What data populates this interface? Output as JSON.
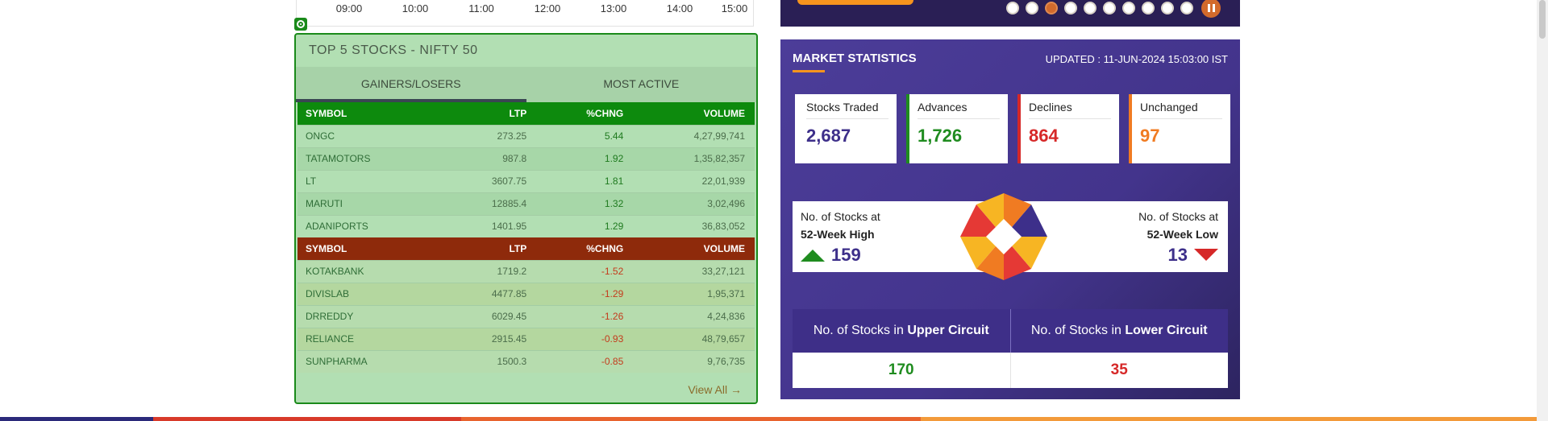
{
  "time_axis": [
    "09:00",
    "10:00",
    "11:00",
    "12:00",
    "13:00",
    "14:00",
    "15:00"
  ],
  "carousel": {
    "dot_count": 10,
    "active_index": 2
  },
  "top5": {
    "title": "TOP 5 STOCKS - NIFTY 50",
    "tabs": [
      "GAINERS/LOSERS",
      "MOST ACTIVE"
    ],
    "active_tab": 0,
    "columns": [
      "SYMBOL",
      "LTP",
      "%CHNG",
      "VOLUME"
    ],
    "gainers": [
      {
        "symbol": "ONGC",
        "ltp": "273.25",
        "chng": "5.44",
        "volume": "4,27,99,741"
      },
      {
        "symbol": "TATAMOTORS",
        "ltp": "987.8",
        "chng": "1.92",
        "volume": "1,35,82,357"
      },
      {
        "symbol": "LT",
        "ltp": "3607.75",
        "chng": "1.81",
        "volume": "22,01,939"
      },
      {
        "symbol": "MARUTI",
        "ltp": "12885.4",
        "chng": "1.32",
        "volume": "3,02,496"
      },
      {
        "symbol": "ADANIPORTS",
        "ltp": "1401.95",
        "chng": "1.29",
        "volume": "36,83,052"
      }
    ],
    "losers": [
      {
        "symbol": "KOTAKBANK",
        "ltp": "1719.2",
        "chng": "-1.52",
        "volume": "33,27,121"
      },
      {
        "symbol": "DIVISLAB",
        "ltp": "4477.85",
        "chng": "-1.29",
        "volume": "1,95,371"
      },
      {
        "symbol": "DRREDDY",
        "ltp": "6029.45",
        "chng": "-1.26",
        "volume": "4,24,836"
      },
      {
        "symbol": "RELIANCE",
        "ltp": "2915.45",
        "chng": "-0.93",
        "volume": "48,79,657"
      },
      {
        "symbol": "SUNPHARMA",
        "ltp": "1500.3",
        "chng": "-0.85",
        "volume": "9,76,735"
      }
    ],
    "view_all": "View All"
  },
  "market": {
    "title": "MARKET STATISTICS",
    "updated": "UPDATED : 11-JUN-2024 15:03:00 IST",
    "cards": [
      {
        "label": "Stocks Traded",
        "value": "2,687"
      },
      {
        "label": "Advances",
        "value": "1,726"
      },
      {
        "label": "Declines",
        "value": "864"
      },
      {
        "label": "Unchanged",
        "value": "97"
      }
    ],
    "week_high": {
      "line1": "No. of Stocks at",
      "line2": "52-Week High",
      "value": "159"
    },
    "week_low": {
      "line1": "No. of Stocks at",
      "line2": "52-Week Low",
      "value": "13"
    },
    "upper_circuit": {
      "prefix": "No. of Stocks in ",
      "bold": "Upper Circuit",
      "value": "170"
    },
    "lower_circuit": {
      "prefix": "No. of Stocks in ",
      "bold": "Lower Circuit",
      "value": "35"
    }
  },
  "colors": {
    "gainer_header": "#0d8a0d",
    "loser_header": "#8e2a0b",
    "market_bg": "#4c3d99",
    "advance": "#1f8c1f",
    "decline": "#d62828",
    "unchanged": "#f07b22",
    "bottom_bar": [
      "#2b2a7a",
      "#d83a2a",
      "#e8632e",
      "#f39a3a"
    ]
  }
}
